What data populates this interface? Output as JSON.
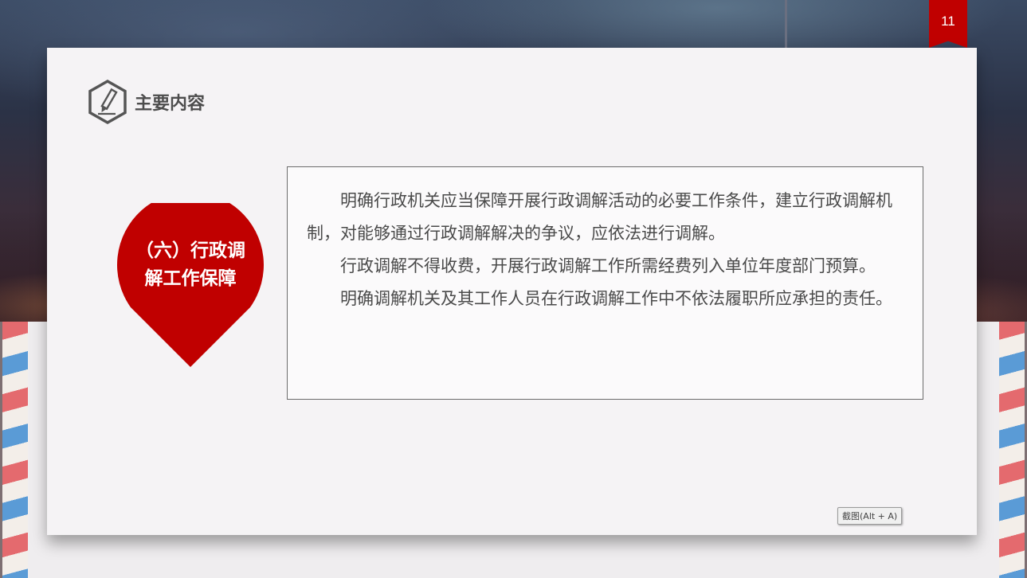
{
  "slide": {
    "page_number": "11",
    "heading": "主要内容",
    "heading_icon": "pencil-hexagon-icon",
    "pin_label": "（六）行政调解工作保障",
    "paragraphs": [
      "明确行政机关应当保障开展行政调解活动的必要工作条件，建立行政调解机制，对能够通过行政调解解决的争议，应依法进行调解。",
      "行政调解不得收费，开展行政调解工作所需经费列入单位年度部门预算。",
      "明确调解机关及其工作人员在行政调解工作中不依法履职所应承担的责任。"
    ]
  },
  "tooltip": {
    "shortcut_label": "截图(Alt + A)"
  },
  "colors": {
    "accent_red": "#c00000",
    "text_gray": "#4a4a4a",
    "stripe_red": "#e46a6e",
    "stripe_blue": "#5a9bd6"
  }
}
